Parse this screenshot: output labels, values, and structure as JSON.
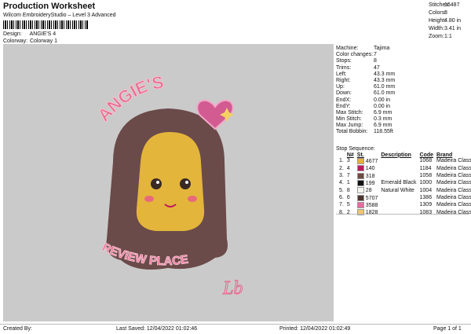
{
  "header": {
    "title": "Production Worksheet",
    "subtitle": "Wilcom EmbroideryStudio – Level 3 Advanced",
    "design_label": "Design:",
    "design_value": "ANGIE'S 4",
    "colorway_label": "Colorway:",
    "colorway_value": "Colorway 1"
  },
  "summary": [
    {
      "label": "Stitches:",
      "value": "16487"
    },
    {
      "label": "Colors:",
      "value": "8"
    },
    {
      "label": "Height:",
      "value": "4.80 in"
    },
    {
      "label": "Width:",
      "value": "3.41 in"
    },
    {
      "label": "Zoom:",
      "value": "1:1"
    }
  ],
  "details": [
    {
      "label": "Machine:",
      "value": "Tajima"
    },
    {
      "label": "Color changes:",
      "value": "7"
    },
    {
      "label": "Stops:",
      "value": "8"
    },
    {
      "label": "Trims:",
      "value": "47"
    },
    {
      "label": "Left:",
      "value": "43.3 mm"
    },
    {
      "label": "Right:",
      "value": "43.3 mm"
    },
    {
      "label": "Up:",
      "value": "61.0 mm"
    },
    {
      "label": "Down:",
      "value": "61.0 mm"
    },
    {
      "label": "EndX:",
      "value": "0.00 in"
    },
    {
      "label": "EndY:",
      "value": "0.00 in"
    },
    {
      "label": "Max Stitch:",
      "value": "6.9 mm"
    },
    {
      "label": "Min Stitch:",
      "value": "0.3 mm"
    },
    {
      "label": "Max Jump:",
      "value": "6.9 mm"
    },
    {
      "label": "Total Bobbin:",
      "value": "118.55ft"
    }
  ],
  "stop_sequence": {
    "title": "Stop Sequence:",
    "columns": [
      "N#",
      "St.",
      "Description",
      "Code",
      "Brand"
    ],
    "rows": [
      {
        "stop": "1.",
        "n": "3",
        "color": "#e8b13a",
        "st": "4677",
        "desc": "",
        "code": "1068",
        "brand": "Madeira Classic 40"
      },
      {
        "stop": "2.",
        "n": "4",
        "color": "#c2185b",
        "st": "140",
        "desc": "",
        "code": "1184",
        "brand": "Madeira Classic 40"
      },
      {
        "stop": "3.",
        "n": "7",
        "color": "#6d4c41",
        "st": "318",
        "desc": "",
        "code": "1058",
        "brand": "Madeira Classic 40"
      },
      {
        "stop": "4.",
        "n": "1",
        "color": "#111111",
        "st": "199",
        "desc": "Emerald Black",
        "code": "1000",
        "brand": "Madeira Classic 40"
      },
      {
        "stop": "5.",
        "n": "8",
        "color": "#f5f5f0",
        "st": "28",
        "desc": "Natural White",
        "code": "1004",
        "brand": "Madeira Classic 40"
      },
      {
        "stop": "6.",
        "n": "6",
        "color": "#4e342e",
        "st": "5707",
        "desc": "",
        "code": "1386",
        "brand": "Madeira Classic 40"
      },
      {
        "stop": "7.",
        "n": "5",
        "color": "#e86aa0",
        "st": "3588",
        "desc": "",
        "code": "1309",
        "brand": "Madeira Classic 40"
      },
      {
        "stop": "8.",
        "n": "2",
        "color": "#f2c46a",
        "st": "1828",
        "desc": "",
        "code": "1083",
        "brand": "Madeira Classic 40"
      }
    ]
  },
  "artwork": {
    "top_text": "ANGIE'S",
    "bottom_text": "REVIEW PLACE",
    "signature": "Lb"
  },
  "footer": {
    "created": "Created By:",
    "saved": "Last Saved: 12/04/2022 01:02:46",
    "printed": "Printed: 12/04/2022 01:02:49",
    "page": "Page 1 of 1"
  }
}
